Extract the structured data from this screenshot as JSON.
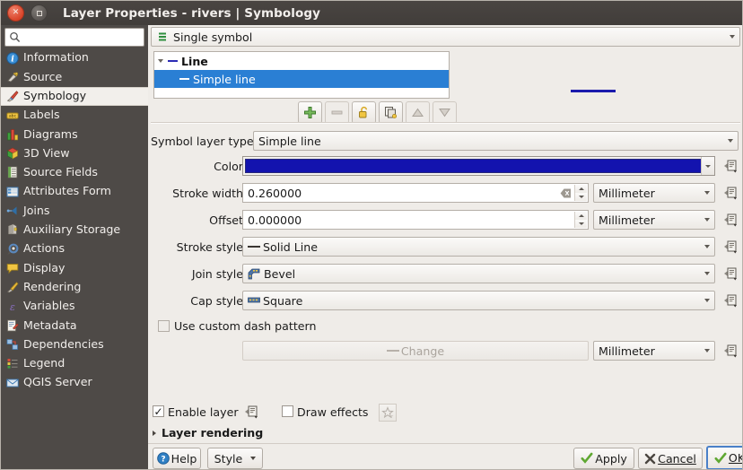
{
  "window": {
    "title": "Layer Properties - rivers | Symbology",
    "close_icon": "close-icon",
    "maximize_icon": "maximize-icon"
  },
  "sidebar": {
    "search": {
      "value": "",
      "placeholder": "",
      "icon": "search-icon"
    },
    "items": [
      {
        "label": "Information",
        "icon": "information-icon",
        "selected": false
      },
      {
        "label": "Source",
        "icon": "source-icon",
        "selected": false
      },
      {
        "label": "Symbology",
        "icon": "symbology-icon",
        "selected": true
      },
      {
        "label": "Labels",
        "icon": "labels-icon",
        "selected": false
      },
      {
        "label": "Diagrams",
        "icon": "diagrams-icon",
        "selected": false
      },
      {
        "label": "3D View",
        "icon": "3d-view-icon",
        "selected": false
      },
      {
        "label": "Source Fields",
        "icon": "source-fields-icon",
        "selected": false
      },
      {
        "label": "Attributes Form",
        "icon": "attributes-form-icon",
        "selected": false
      },
      {
        "label": "Joins",
        "icon": "joins-icon",
        "selected": false
      },
      {
        "label": "Auxiliary Storage",
        "icon": "auxiliary-storage-icon",
        "selected": false
      },
      {
        "label": "Actions",
        "icon": "actions-icon",
        "selected": false
      },
      {
        "label": "Display",
        "icon": "display-icon",
        "selected": false
      },
      {
        "label": "Rendering",
        "icon": "rendering-icon",
        "selected": false
      },
      {
        "label": "Variables",
        "icon": "variables-icon",
        "selected": false
      },
      {
        "label": "Metadata",
        "icon": "metadata-icon",
        "selected": false
      },
      {
        "label": "Dependencies",
        "icon": "dependencies-icon",
        "selected": false
      },
      {
        "label": "Legend",
        "icon": "legend-icon",
        "selected": false
      },
      {
        "label": "QGIS Server",
        "icon": "qgis-server-icon",
        "selected": false
      }
    ]
  },
  "symbology": {
    "renderer": {
      "label": "Single symbol",
      "icon": "single-symbol-icon"
    },
    "tree": {
      "parent": {
        "label": "Line",
        "expanded": true
      },
      "child": {
        "label": "Simple line",
        "selected": true
      }
    },
    "layer_toolbar": [
      {
        "name": "add-symbol-layer-button",
        "icon": "plus-icon",
        "enabled": true
      },
      {
        "name": "remove-symbol-layer-button",
        "icon": "minus-icon",
        "enabled": false
      },
      {
        "name": "lock-layer-button",
        "icon": "lock-open-icon",
        "enabled": true
      },
      {
        "name": "duplicate-layer-button",
        "icon": "duplicate-icon",
        "enabled": true
      },
      {
        "name": "move-up-button",
        "icon": "arrow-up-icon",
        "enabled": false
      },
      {
        "name": "move-down-button",
        "icon": "arrow-down-icon",
        "enabled": false
      }
    ],
    "preview": {
      "line_color": "#1b1bad"
    },
    "symbol_layer_type": {
      "label": "Symbol layer type",
      "value": "Simple line"
    },
    "fields": {
      "color": {
        "label": "Color",
        "value_color": "#1313ae",
        "override_icon": "data-defined-override-icon"
      },
      "stroke_width": {
        "label": "Stroke width",
        "value": "0.260000",
        "unit": "Millimeter",
        "clear_icon": "clear-icon",
        "override_icon": "data-defined-override-icon"
      },
      "offset": {
        "label": "Offset",
        "value": "0.000000",
        "unit": "Millimeter",
        "override_icon": "data-defined-override-icon"
      },
      "stroke_style": {
        "label": "Stroke style",
        "value": "Solid Line",
        "icon": "solid-line-icon",
        "override_icon": "data-defined-override-icon"
      },
      "join_style": {
        "label": "Join style",
        "value": "Bevel",
        "icon": "bevel-join-icon",
        "override_icon": "data-defined-override-icon"
      },
      "cap_style": {
        "label": "Cap style",
        "value": "Square",
        "icon": "square-cap-icon",
        "override_icon": "data-defined-override-icon"
      },
      "custom_dash": {
        "label": "Use custom dash pattern",
        "checked": false
      },
      "dash_change": {
        "label": "Change",
        "enabled": false,
        "unit": "Millimeter",
        "override_icon": "data-defined-override-icon"
      }
    },
    "enable_layer": {
      "label": "Enable layer",
      "checked": true,
      "override_icon": "data-defined-override-icon"
    },
    "draw_effects": {
      "label": "Draw effects",
      "checked": false,
      "effects_icon": "effects-star-icon"
    },
    "layer_rendering": {
      "label": "Layer rendering",
      "expanded": false
    }
  },
  "buttonbar": {
    "help": {
      "label": "Help",
      "icon": "help-icon"
    },
    "style": {
      "label": "Style",
      "icon": "chevron-down-icon"
    },
    "apply": {
      "label": "Apply",
      "icon": "check-icon"
    },
    "cancel": {
      "label": "Cancel",
      "icon": "cross-icon"
    },
    "ok": {
      "label": "OK",
      "icon": "check-icon",
      "focused": true
    }
  },
  "colors": {
    "accent_blue": "#2a7fd4",
    "symbol_blue": "#1313ae",
    "titlebar": "#423e3b",
    "sidebar": "#4e4a47",
    "panel_bg": "#efece8"
  }
}
